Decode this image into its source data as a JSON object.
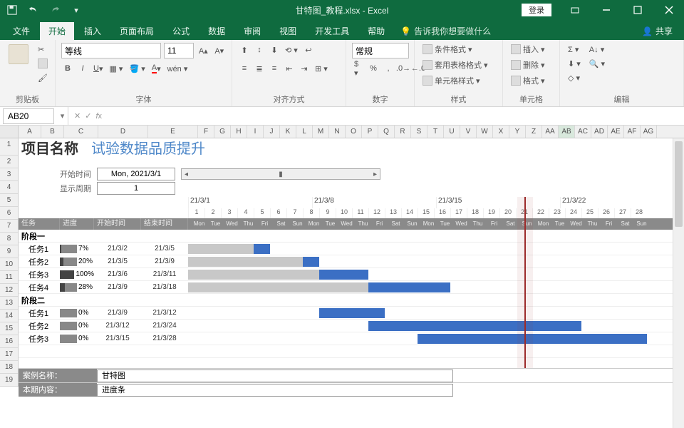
{
  "window": {
    "filename": "甘特图_教程.xlsx",
    "app": "Excel",
    "login": "登录"
  },
  "tabs": {
    "file": "文件",
    "home": "开始",
    "insert": "插入",
    "layout": "页面布局",
    "formulas": "公式",
    "data": "数据",
    "review": "审阅",
    "view": "视图",
    "dev": "开发工具",
    "help": "帮助",
    "tellme": "告诉我你想要做什么",
    "share": "共享"
  },
  "ribbon": {
    "clipboard": "剪贴板",
    "font_group": "字体",
    "align_group": "对齐方式",
    "number_group": "数字",
    "styles_group": "样式",
    "cells_group": "单元格",
    "editing_group": "编辑",
    "font_name": "等线",
    "font_size": "11",
    "number_fmt": "常规",
    "cond_fmt": "条件格式",
    "table_fmt": "套用表格格式",
    "cell_styles": "单元格样式",
    "insert": "插入",
    "delete": "删除",
    "format": "格式"
  },
  "namebox": "AB20",
  "sheet": {
    "title_label": "项目名称",
    "title_value": "试验数据品质提升",
    "start_label": "开始时间",
    "start_value": "Mon, 2021/3/1",
    "period_label": "显示周期",
    "period_value": "1",
    "timeline_dates": [
      "21/3/1",
      "21/3/8",
      "21/3/15",
      "21/3/22"
    ],
    "timeline_nums": [
      "1",
      "2",
      "3",
      "4",
      "5",
      "6",
      "7",
      "8",
      "9",
      "10",
      "11",
      "12",
      "13",
      "14",
      "15",
      "16",
      "17",
      "18",
      "19",
      "20",
      "21",
      "22",
      "23",
      "24",
      "25",
      "26",
      "27",
      "28"
    ],
    "timeline_days": [
      "Mon",
      "Tue",
      "Wed",
      "Thu",
      "Fri",
      "Sat",
      "Sun",
      "Mon",
      "Tue",
      "Wed",
      "Thu",
      "Fri",
      "Sat",
      "Sun",
      "Mon",
      "Tue",
      "Wed",
      "Thu",
      "Fri",
      "Sat",
      "Sun",
      "Mon",
      "Tue",
      "Wed",
      "Thu",
      "Fri",
      "Sat",
      "Sun"
    ],
    "hdr_task": "任务",
    "hdr_prog": "进度",
    "hdr_start": "开始时间",
    "hdr_end": "结束时间",
    "phase1": "阶段一",
    "phase2": "阶段二",
    "tasks": [
      {
        "name": "任务1",
        "prog": "7%",
        "start": "21/3/2",
        "end": "21/3/5"
      },
      {
        "name": "任务2",
        "prog": "20%",
        "start": "21/3/5",
        "end": "21/3/9"
      },
      {
        "name": "任务3",
        "prog": "100%",
        "start": "21/3/6",
        "end": "21/3/11"
      },
      {
        "name": "任务4",
        "prog": "28%",
        "start": "21/3/9",
        "end": "21/3/18"
      }
    ],
    "tasks2": [
      {
        "name": "任务1",
        "prog": "0%",
        "start": "21/3/9",
        "end": "21/3/12"
      },
      {
        "name": "任务2",
        "prog": "0%",
        "start": "21/3/12",
        "end": "21/3/24"
      },
      {
        "name": "任务3",
        "prog": "0%",
        "start": "21/3/15",
        "end": "21/3/28"
      }
    ],
    "info1_label": "案例名称：",
    "info1_value": "甘特图",
    "info2_label": "本期内容：",
    "info2_value": "进度条"
  },
  "cols": [
    "A",
    "B",
    "C",
    "D",
    "E",
    "F",
    "G",
    "H",
    "I",
    "J",
    "K",
    "L",
    "M",
    "N",
    "O",
    "P",
    "Q",
    "R",
    "S",
    "T",
    "U",
    "V",
    "W",
    "X",
    "Y",
    "Z",
    "AA",
    "AB",
    "AC",
    "AD",
    "AE",
    "AF",
    "AG"
  ]
}
